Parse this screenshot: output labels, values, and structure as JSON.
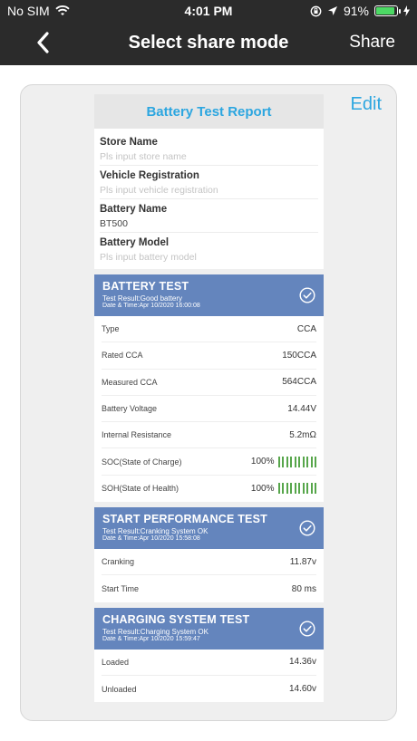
{
  "status": {
    "carrier": "No SIM",
    "time": "4:01 PM",
    "battery_pct": "91%"
  },
  "nav": {
    "title": "Select share mode",
    "share_label": "Share"
  },
  "edit_label": "Edit",
  "report": {
    "title": "Battery Test Report",
    "fields": [
      {
        "label": "Store Name",
        "placeholder": "Pls input store name"
      },
      {
        "label": "Vehicle Registration",
        "placeholder": "Pls input vehicle registration"
      },
      {
        "label": "Battery Name",
        "value": "BT500"
      },
      {
        "label": "Battery Model",
        "placeholder": "Pls input battery model"
      }
    ]
  },
  "battery_test": {
    "title": "BATTERY TEST",
    "result": "Test Result:Good battery",
    "datetime": "Date & Time:Apr 10/2020 16:00:08",
    "rows": [
      {
        "label": "Type",
        "value": "CCA"
      },
      {
        "label": "Rated CCA",
        "value": "150CCA"
      },
      {
        "label": "Measured CCA",
        "value": "564CCA"
      },
      {
        "label": "Battery Voltage",
        "value": "14.44V"
      },
      {
        "label": "Internal Resistance",
        "value": "5.2mΩ"
      },
      {
        "label": "SOC(State of Charge)",
        "value": "100%",
        "level": 1.0
      },
      {
        "label": "SOH(State of Health)",
        "value": "100%",
        "level": 1.0
      }
    ]
  },
  "start_test": {
    "title": "START PERFORMANCE TEST",
    "result": "Test Result:Cranking System OK",
    "datetime": "Date & Time:Apr 10/2020 15:58:08",
    "rows": [
      {
        "label": "Cranking",
        "value": "11.87v"
      },
      {
        "label": "Start Time",
        "value": "80 ms"
      }
    ]
  },
  "charging_test": {
    "title": "CHARGING SYSTEM TEST",
    "result": "Test Result:Charging System OK",
    "datetime": "Date & Time:Apr 10/2020 15:59:47",
    "rows": [
      {
        "label": "Loaded",
        "value": "14.36v"
      },
      {
        "label": "Unloaded",
        "value": "14.60v"
      }
    ]
  },
  "colors": {
    "accent": "#2ca6e0",
    "section_header": "#6485bd",
    "bar_green": "#57a64b",
    "nav_bg": "#2b2b2b"
  }
}
